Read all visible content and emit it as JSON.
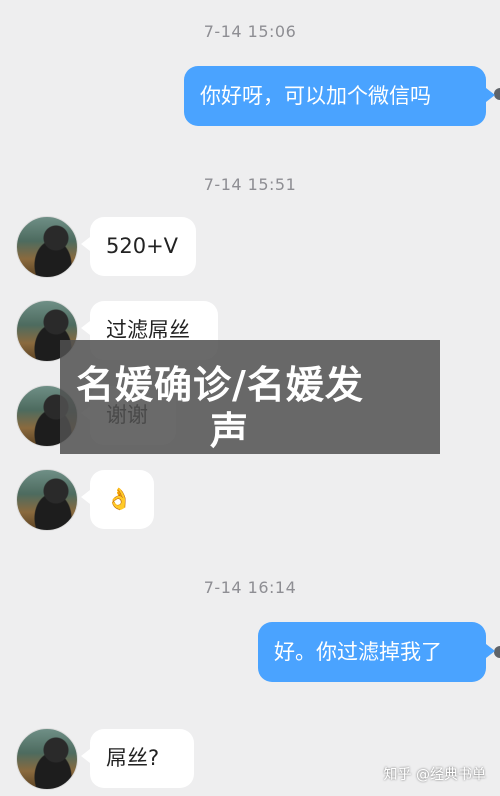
{
  "timestamps": [
    "7-14 15:06",
    "7-14 15:51",
    "7-14 16:14"
  ],
  "messages": {
    "m1": "你好呀，可以加个微信吗",
    "m2": "520+V",
    "m3": "过滤屌丝",
    "m4": "谢谢",
    "m5": "👌",
    "m6": "好。你过滤掉我了",
    "m7": "屌丝?"
  },
  "overlay": {
    "line1": "名媛确诊/名媛发",
    "line2": "声"
  },
  "watermark": "知乎 @经典书单",
  "colors": {
    "outgoing_bubble": "#4aa3ff",
    "incoming_bubble": "#ffffff",
    "background": "#eeeeef"
  }
}
